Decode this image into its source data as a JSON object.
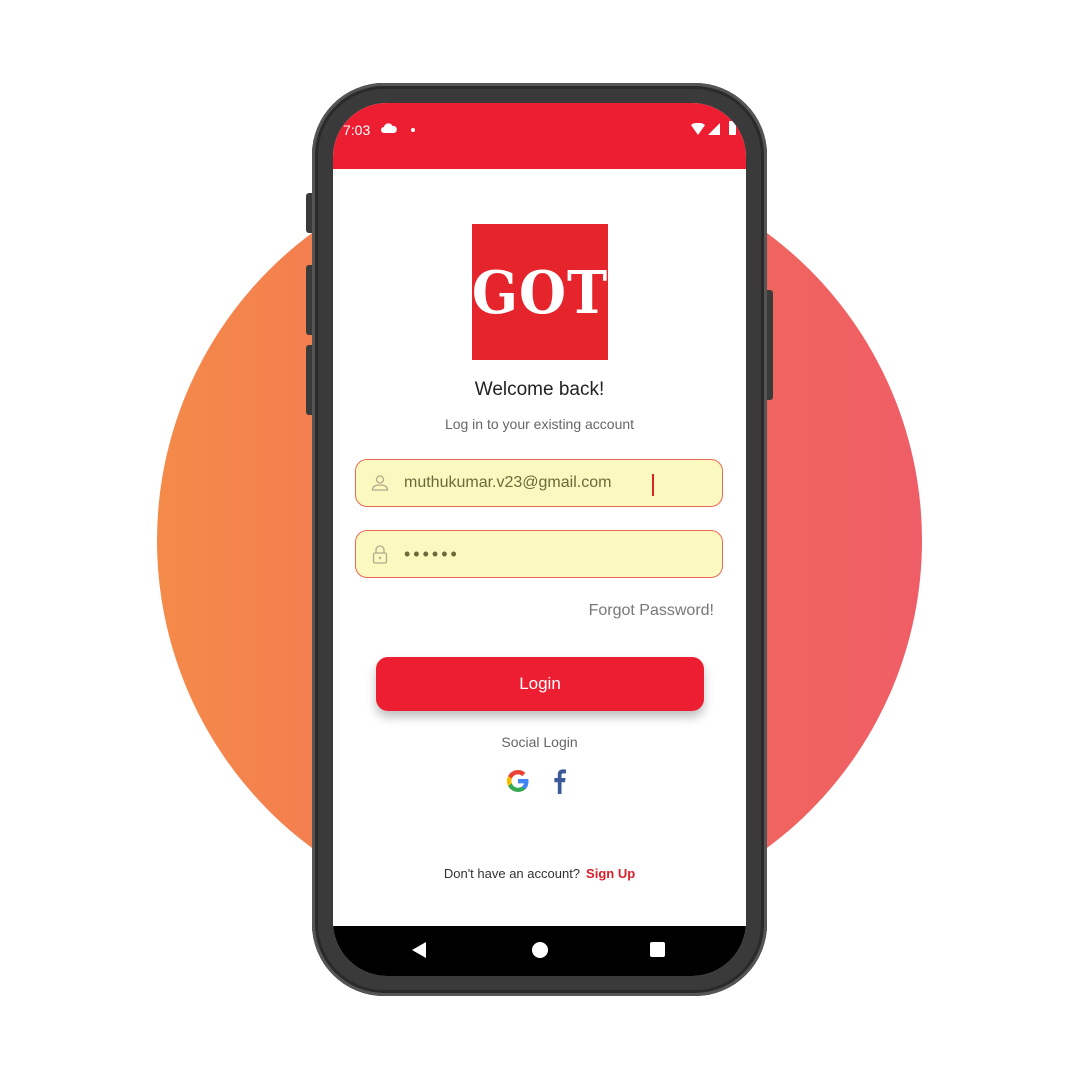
{
  "status_bar": {
    "time": "7:03",
    "icons": [
      "cloud-icon",
      "dot-icon",
      "wifi-icon",
      "signal-icon",
      "battery-icon"
    ]
  },
  "logo": {
    "text": "GOT"
  },
  "header": {
    "title": "Welcome back!",
    "subtitle": "Log in to your existing account"
  },
  "form": {
    "email_value": "muthukumar.v23@gmail.com",
    "password_value": "••••••",
    "forgot_label": "Forgot Password!",
    "login_label": "Login"
  },
  "social": {
    "label": "Social Login",
    "providers": [
      "google-icon",
      "facebook-icon"
    ]
  },
  "footer": {
    "prompt": "Don't have an account?",
    "signup_label": "Sign Up"
  },
  "colors": {
    "brand_red": "#ed1e32",
    "field_bg": "#fbf8c0",
    "field_border": "#e86a53",
    "background_gradient_start": "#f48a4a",
    "background_gradient_end": "#ef5e66"
  }
}
